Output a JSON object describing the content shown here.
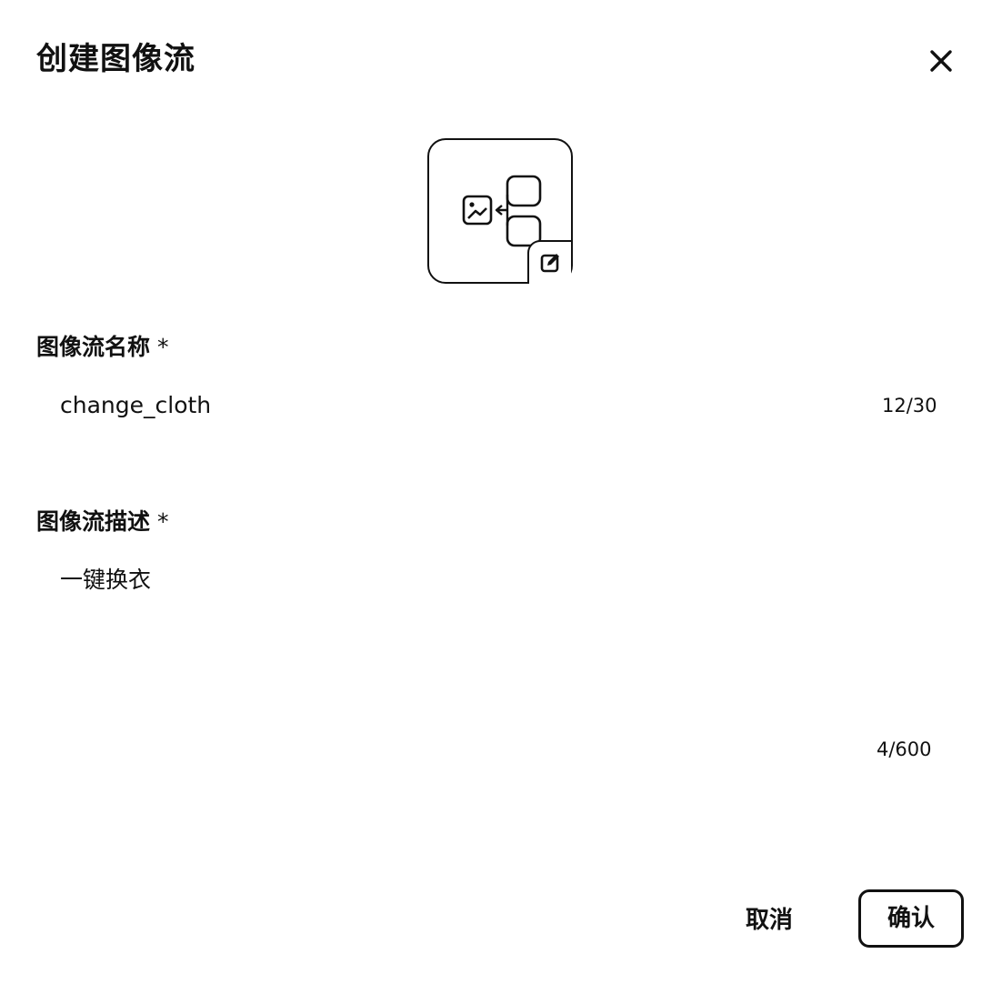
{
  "dialog": {
    "title": "创建图像流",
    "close_icon": "close-icon"
  },
  "avatar": {
    "icon": "image-flow-icon",
    "edit_icon": "edit-icon"
  },
  "name_field": {
    "label": "图像流名称",
    "required_mark": "*",
    "value": "change_cloth",
    "counter": "12/30"
  },
  "description_field": {
    "label": "图像流描述",
    "required_mark": "*",
    "value": "一键换衣",
    "counter": "4/600"
  },
  "footer": {
    "cancel_label": "取消",
    "confirm_label": "确认"
  }
}
